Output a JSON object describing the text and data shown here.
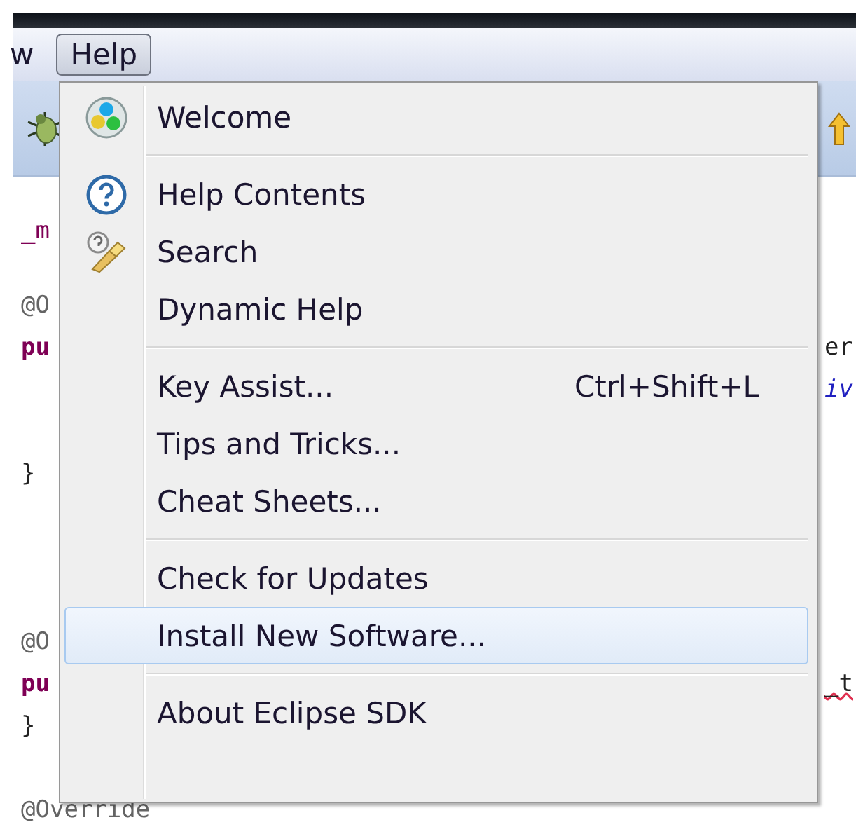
{
  "menubar": {
    "items": [
      {
        "label": "w",
        "selected": false
      },
      {
        "label": "Help",
        "selected": true
      }
    ]
  },
  "editor": {
    "blocks": [
      [
        {
          "left": "_m"
        }
      ],
      [
        {
          "left": "@O"
        },
        {
          "left": "pu",
          "right": "er"
        },
        {
          "right": "iv"
        }
      ],
      [
        {
          "left": "}"
        }
      ],
      [
        {
          "left": "@O"
        },
        {
          "left": "pu",
          "right": "_t"
        },
        {
          "left": "}"
        }
      ],
      [
        {
          "left": "@Override"
        }
      ]
    ]
  },
  "help_menu": {
    "groups": [
      [
        {
          "label": "Welcome",
          "kind": "welcome",
          "selected": false
        }
      ],
      [
        {
          "label": "Help Contents",
          "kind": "help",
          "selected": false
        },
        {
          "label": "Search",
          "kind": "search",
          "selected": false
        },
        {
          "label": "Dynamic Help",
          "kind": "plain",
          "selected": false
        }
      ],
      [
        {
          "label": "Key Assist...",
          "kind": "plain",
          "shortcut": "Ctrl+Shift+L",
          "selected": false
        },
        {
          "label": "Tips and Tricks...",
          "kind": "plain",
          "selected": false
        },
        {
          "label": "Cheat Sheets...",
          "kind": "plain",
          "selected": false
        }
      ],
      [
        {
          "label": "Check for Updates",
          "kind": "plain",
          "selected": false
        },
        {
          "label": "Install New Software...",
          "kind": "plain",
          "selected": true
        }
      ],
      [
        {
          "label": "About Eclipse SDK",
          "kind": "plain",
          "selected": false
        }
      ]
    ]
  }
}
